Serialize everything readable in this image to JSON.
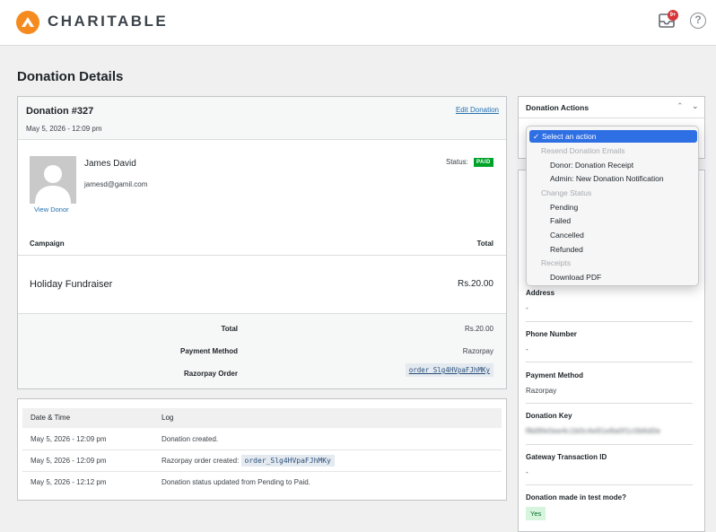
{
  "header": {
    "brand": "CHARITABLE",
    "notification_count": "9+",
    "help_icon": "?"
  },
  "page": {
    "title": "Donation Details"
  },
  "donation": {
    "title": "Donation #327",
    "date": "May 5, 2026 - 12:09 pm",
    "edit_link": "Edit Donation",
    "donor_name": "James David",
    "donor_email": "jamesd@gamil.com",
    "view_donor": "View Donor",
    "status_label": "Status:",
    "status_value": "PAID",
    "table": {
      "col_campaign": "Campaign",
      "col_total": "Total",
      "rows": [
        {
          "campaign": "Holiday Fundraiser",
          "total": "Rs.20.00"
        }
      ]
    },
    "summary": {
      "total_label": "Total",
      "total_value": "Rs.20.00",
      "payment_label": "Payment Method",
      "payment_value": "Razorpay",
      "order_label": "Razorpay Order",
      "order_value": "order_Slg4HVpaFJhMKy"
    }
  },
  "log": {
    "col_date": "Date & Time",
    "col_log": "Log",
    "rows": [
      {
        "date": "May 5, 2026 - 12:09 pm",
        "text": "Donation created.",
        "code": ""
      },
      {
        "date": "May 5, 2026 - 12:09 pm",
        "text": "Razorpay order created:",
        "code": "order_Slg4HVpaFJhMKy"
      },
      {
        "date": "May 5, 2026 - 12:12 pm",
        "text": "Donation status updated from Pending to Paid.",
        "code": ""
      }
    ]
  },
  "actions": {
    "title": "Donation Actions",
    "select_placeholder": "Select an action",
    "groups": [
      {
        "label": "Resend Donation Emails",
        "options": [
          "Donor: Donation Receipt",
          "Admin: New Donation Notification"
        ]
      },
      {
        "label": "Change Status",
        "options": [
          "Pending",
          "Failed",
          "Cancelled",
          "Refunded"
        ]
      },
      {
        "label": "Receipts",
        "options": [
          "Download PDF"
        ]
      }
    ]
  },
  "sidebar": {
    "address_label": "Address",
    "address_value": "-",
    "phone_label": "Phone Number",
    "phone_value": "-",
    "payment_label": "Payment Method",
    "payment_value": "Razorpay",
    "key_label": "Donation Key",
    "key_value": "f8d9fe0ee4c1b0c4e91e8a0f1c0b6d0e",
    "gateway_label": "Gateway Transaction ID",
    "gateway_value": "-",
    "test_label": "Donation made in test mode?",
    "test_value": "Yes"
  },
  "colors": {
    "brand_orange": "#f58a1f",
    "link_blue": "#2271b1",
    "paid_green": "#00a32a",
    "select_blue": "#2f6fe4"
  }
}
